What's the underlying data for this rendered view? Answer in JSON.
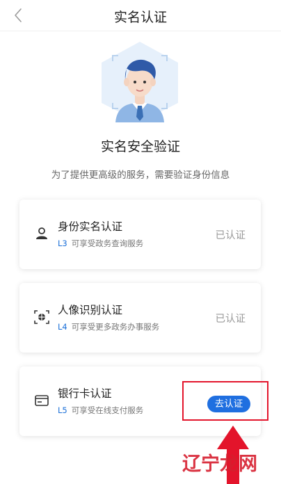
{
  "header": {
    "title": "实名认证"
  },
  "intro": {
    "headline": "实名安全验证",
    "description": "为了提供更高级的服务，需要验证身份信息"
  },
  "cards": [
    {
      "title": "身份实名认证",
      "level": "L3",
      "desc": "可享受政务查询服务",
      "status": "已认证",
      "icon": "person-icon"
    },
    {
      "title": "人像识别认证",
      "level": "L4",
      "desc": "可享受更多政务办事服务",
      "status": "已认证",
      "icon": "face-scan-icon"
    },
    {
      "title": "银行卡认证",
      "level": "L5",
      "desc": "可享受在线支付服务",
      "action": "去认证",
      "icon": "bank-card-icon"
    }
  ],
  "watermark": {
    "text": "辽宁龙网"
  },
  "colors": {
    "accent": "#1f6fe0",
    "highlight": "#e3142b",
    "level": "#1a6fd8"
  }
}
